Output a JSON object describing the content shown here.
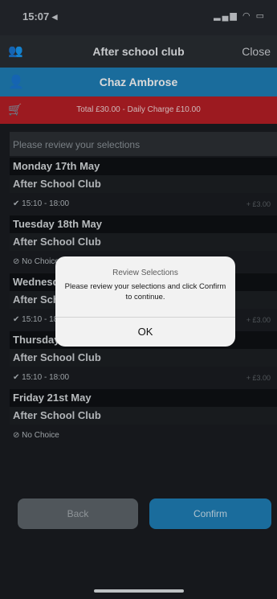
{
  "status_bar": {
    "time": "15:07 ◂",
    "icons": "▂▄▆ ◠ ▭"
  },
  "nav": {
    "title": "After school club",
    "close_label": "Close",
    "left_icon": "group-icon"
  },
  "user": {
    "name": "Chaz Ambrose",
    "icon": "person-icon"
  },
  "cart": {
    "text": "Total £30.00 - Daily Charge £10.00",
    "icon": "cart-icon"
  },
  "review": {
    "heading": "Please review your selections"
  },
  "days": [
    {
      "day": "Monday 17th May",
      "club": "After School Club",
      "slot": "✔ 15:10 - 18:00",
      "price": "+ £3.00"
    },
    {
      "day": "Tuesday 18th May",
      "club": "After School Club",
      "slot": "⊘ No Choice",
      "price": ""
    },
    {
      "day": "Wednesday 19th May",
      "club": "After School Club",
      "slot": "✔ 15:10 - 18:00",
      "price": "+ £3.00"
    },
    {
      "day": "Thursday 20th May",
      "club": "After School Club",
      "slot": "✔ 15:10 - 18:00",
      "price": "+ £3.00"
    },
    {
      "day": "Friday 21st May",
      "club": "After School Club",
      "slot": "⊘ No Choice",
      "price": ""
    }
  ],
  "buttons": {
    "back": "Back",
    "confirm": "Confirm"
  },
  "dialog": {
    "title": "Review Selections",
    "message": "Please review your selections and click Confirm to continue.",
    "ok": "OK"
  },
  "colors": {
    "accent": "#1f7fb8",
    "cart_red": "#b81f26",
    "background": "#1a1d21"
  }
}
